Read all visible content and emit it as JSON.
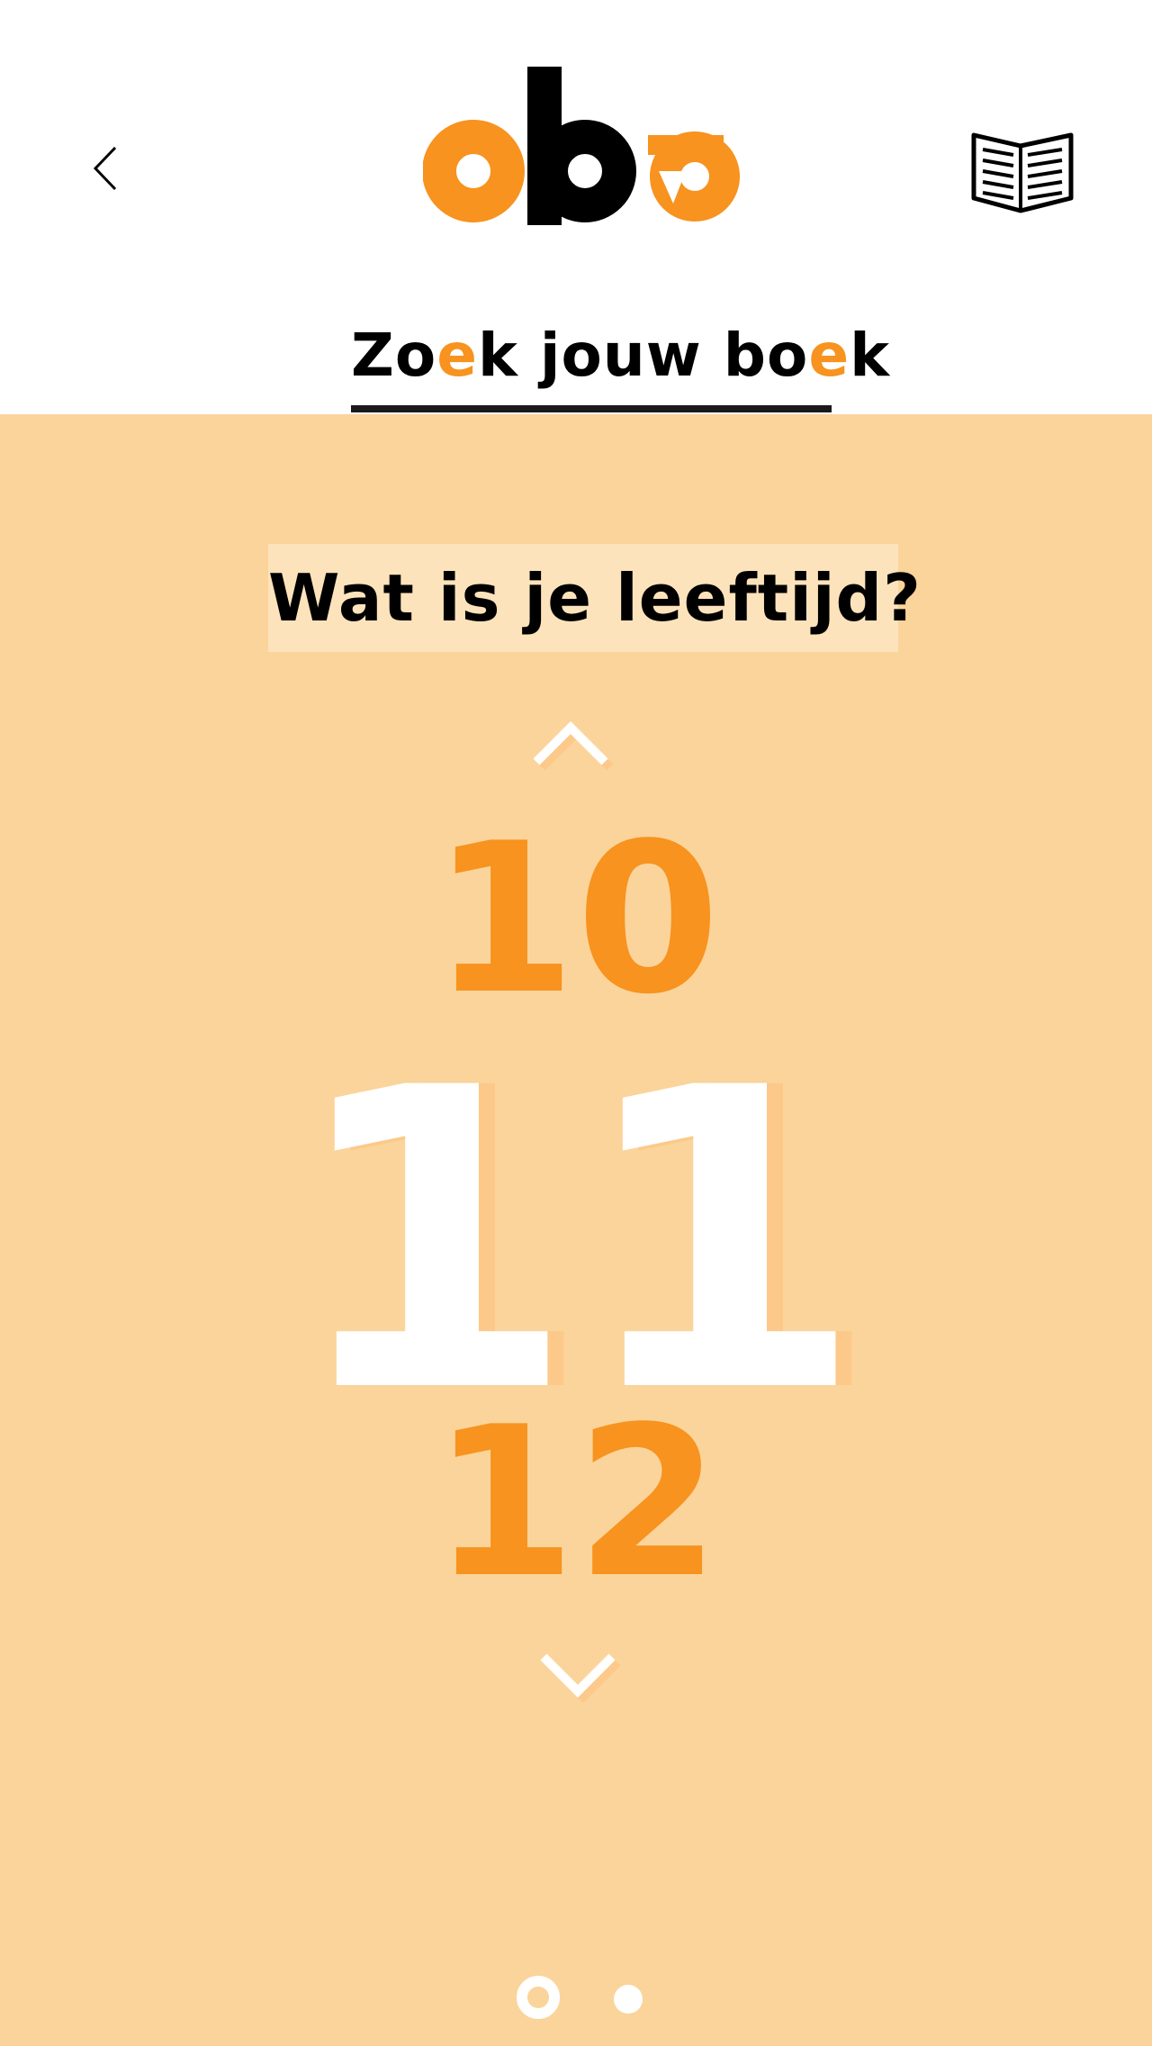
{
  "header": {
    "back_icon": "chevron-left-icon",
    "logo_text": "oba",
    "book_icon": "open-book-icon",
    "title_parts": [
      "Zo",
      "e",
      "k jouw bo",
      "e",
      "k"
    ]
  },
  "main": {
    "question": "Wat is je leeftijd?",
    "up_icon": "chevron-up-icon",
    "down_icon": "chevron-down-icon",
    "age_prev": "10",
    "age_current": "11",
    "age_next": "12"
  },
  "pagination": {
    "total": 2,
    "active": 1
  },
  "colors": {
    "accent": "#f7931e",
    "panel_bg": "#fbd49b",
    "question_bg": "#fde3bb",
    "white": "#ffffff"
  }
}
